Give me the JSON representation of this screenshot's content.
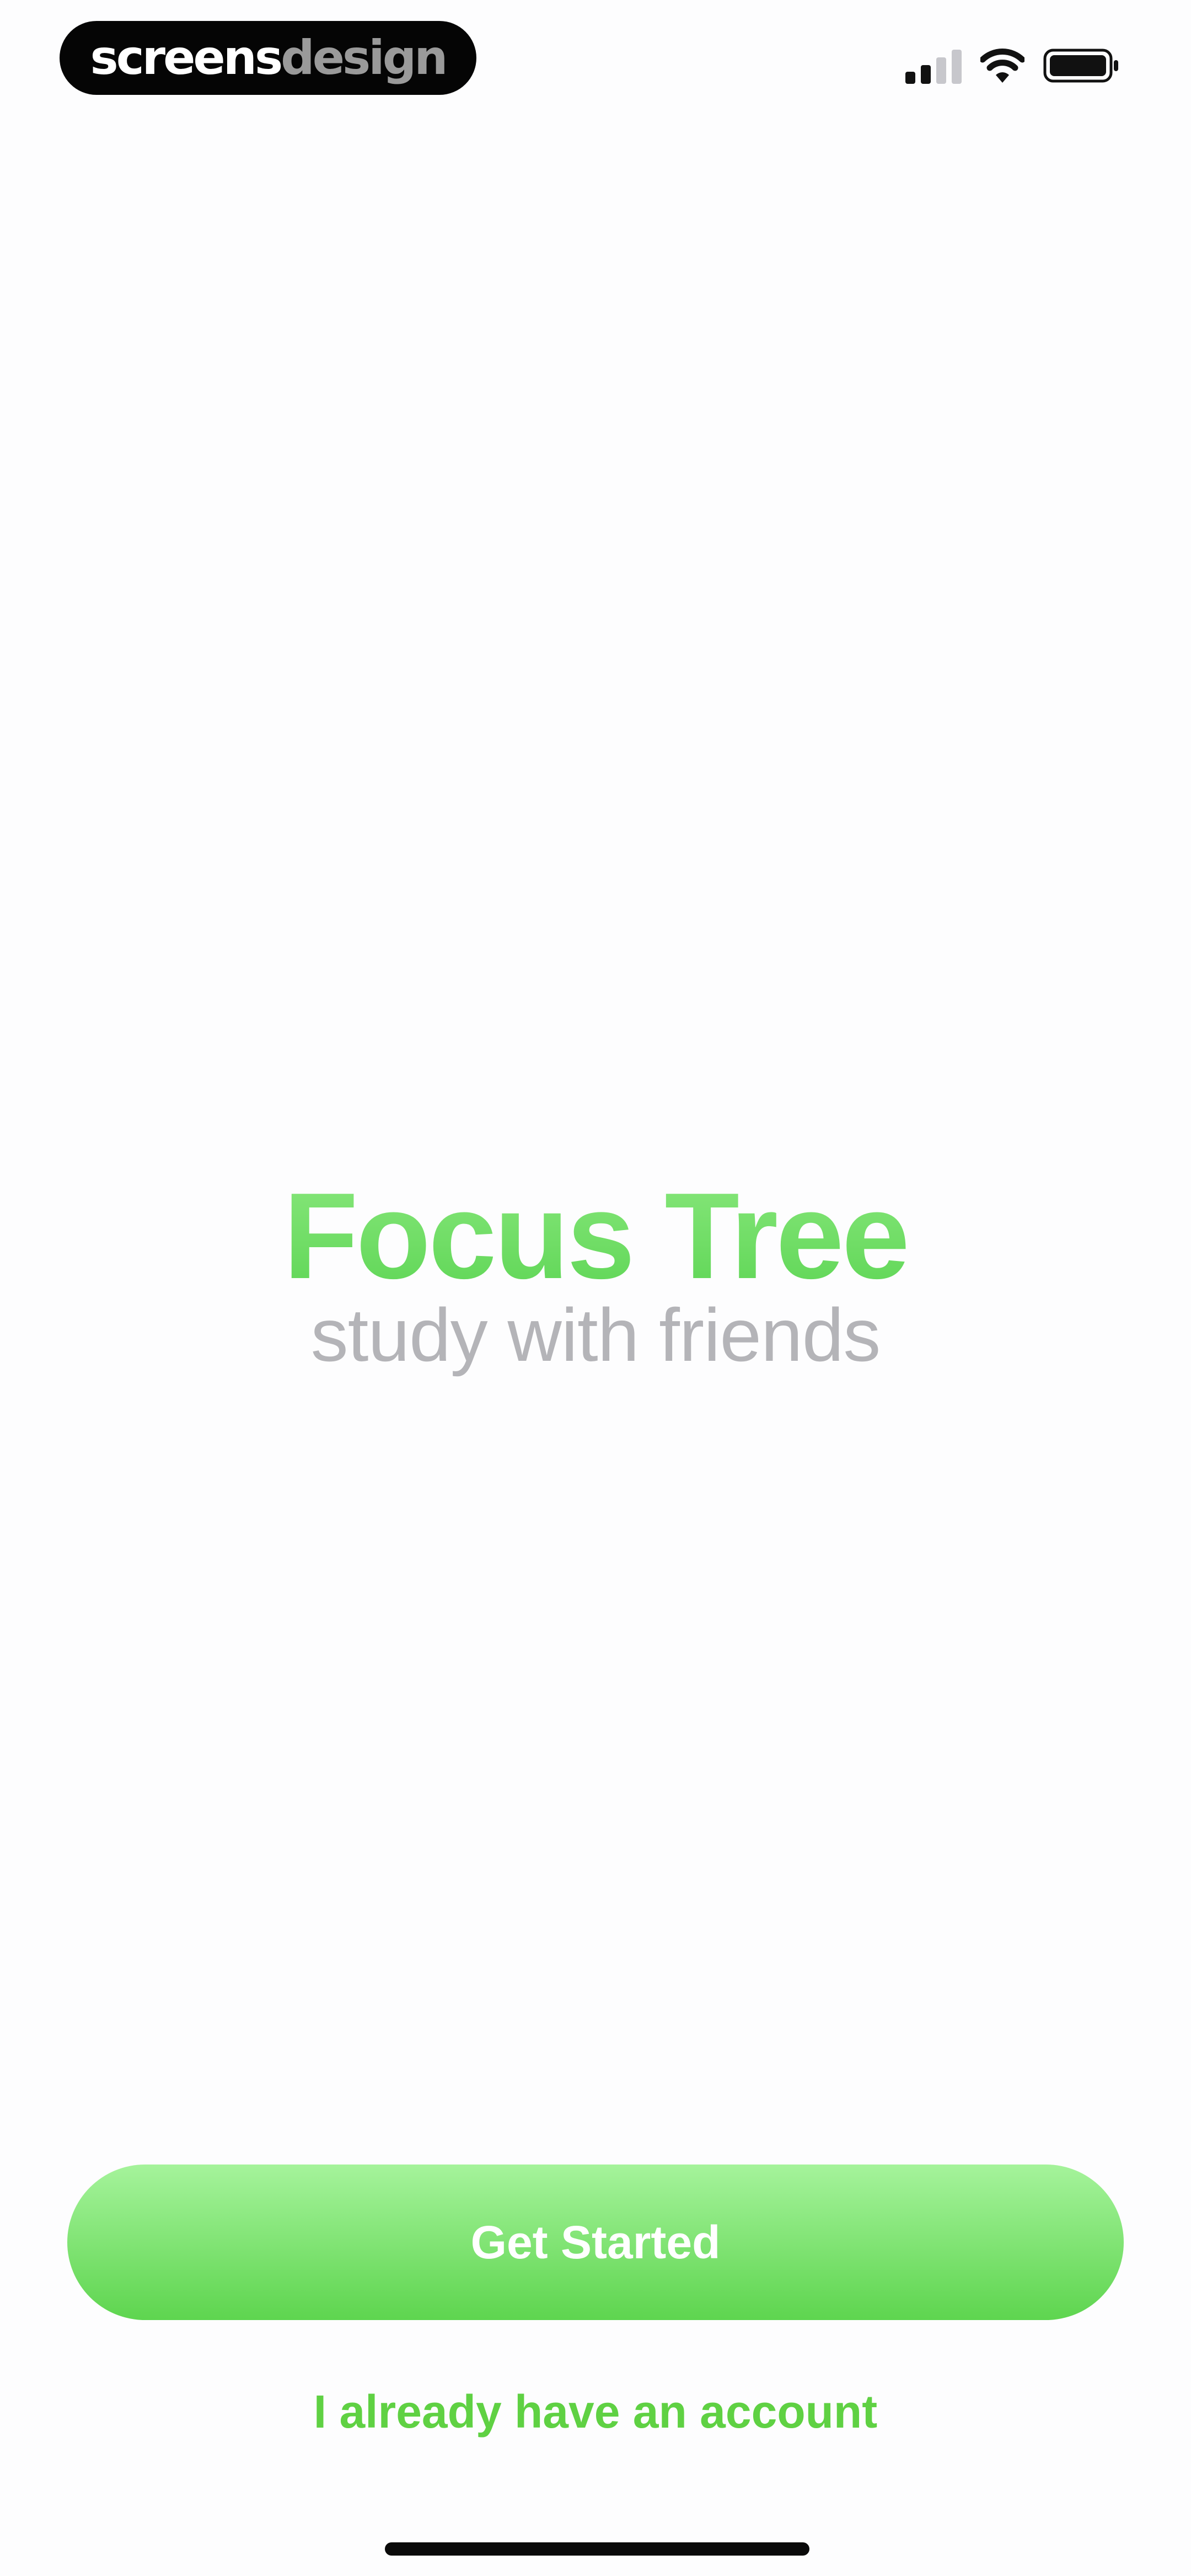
{
  "status_bar": {
    "brand_primary": "screens",
    "brand_secondary": "design",
    "icons": [
      "cellular-signal-icon",
      "wifi-icon",
      "battery-icon"
    ]
  },
  "splash": {
    "title": "Focus Tree",
    "subtitle": "study with friends"
  },
  "actions": {
    "primary_label": "Get Started",
    "secondary_label": "I already have an account"
  },
  "colors": {
    "accent_green": "#5fd656",
    "button_gradient_top": "#a5f39b",
    "button_gradient_bottom": "#5ed54f",
    "link_green": "#5fd143",
    "subtitle_gray": "#b4b4b8",
    "background": "#fdfdfe"
  }
}
